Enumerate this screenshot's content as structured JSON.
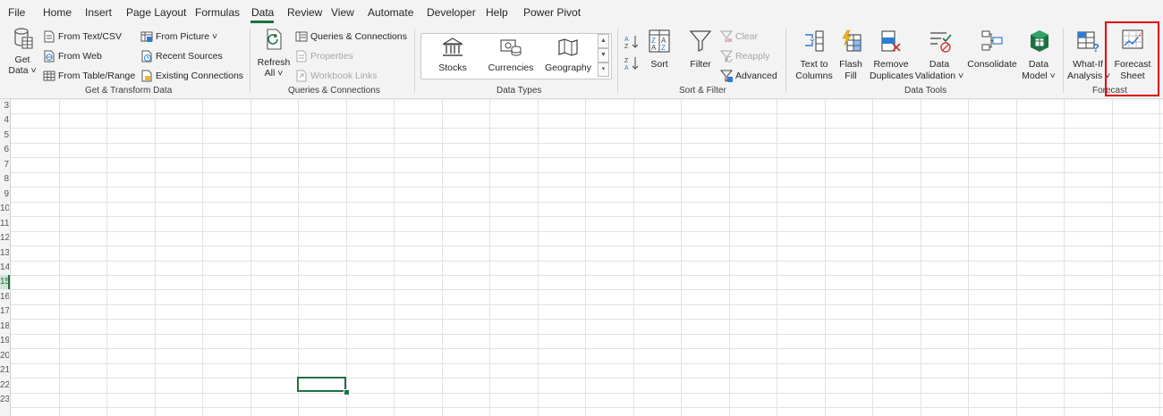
{
  "menu_tabs": [
    "File",
    "Home",
    "Insert",
    "Page Layout",
    "Formulas",
    "Data",
    "Review",
    "View",
    "Automate",
    "Developer",
    "Help",
    "Power Pivot"
  ],
  "active_tab": "Data",
  "groups": {
    "get_transform": {
      "label": "Get & Transform Data",
      "get_data": {
        "line1": "Get",
        "line2": "Data ˅"
      },
      "from_text_csv": "From Text/CSV",
      "from_web": "From Web",
      "from_table_range": "From Table/Range",
      "from_picture": "From Picture ˅",
      "recent_sources": "Recent Sources",
      "existing_connections": "Existing Connections"
    },
    "queries": {
      "label": "Queries & Connections",
      "refresh_all": {
        "line1": "Refresh",
        "line2": "All ˅"
      },
      "queries_connections": "Queries & Connections",
      "properties": "Properties",
      "workbook_links": "Workbook Links"
    },
    "data_types": {
      "label": "Data Types",
      "stocks": "Stocks",
      "currencies": "Currencies",
      "geography": "Geography"
    },
    "sort_filter": {
      "label": "Sort & Filter",
      "sort": "Sort",
      "filter": "Filter",
      "clear": "Clear",
      "reapply": "Reapply",
      "advanced": "Advanced"
    },
    "data_tools": {
      "label": "Data Tools",
      "text_to_columns": {
        "line1": "Text to",
        "line2": "Columns"
      },
      "flash_fill": {
        "line1": "Flash",
        "line2": "Fill"
      },
      "remove_duplicates": {
        "line1": "Remove",
        "line2": "Duplicates"
      },
      "data_validation": {
        "line1": "Data",
        "line2": "Validation ˅"
      },
      "consolidate": "Consolidate",
      "data_model": {
        "line1": "Data",
        "line2": "Model ˅"
      }
    },
    "forecast": {
      "label": "Forecast",
      "what_if": {
        "line1": "What-If",
        "line2": "Analysis ˅"
      },
      "forecast_sheet": {
        "line1": "Forecast",
        "line2": "Sheet"
      }
    }
  },
  "row_numbers": [
    "3",
    "4",
    "5",
    "6",
    "7",
    "8",
    "9",
    "10",
    "11",
    "12",
    "13",
    "14",
    "15",
    "16",
    "17",
    "18",
    "19",
    "20",
    "21",
    "22",
    "23"
  ],
  "active_row": "15",
  "colors": {
    "accent": "#1e7145",
    "highlight": "#e00000"
  }
}
